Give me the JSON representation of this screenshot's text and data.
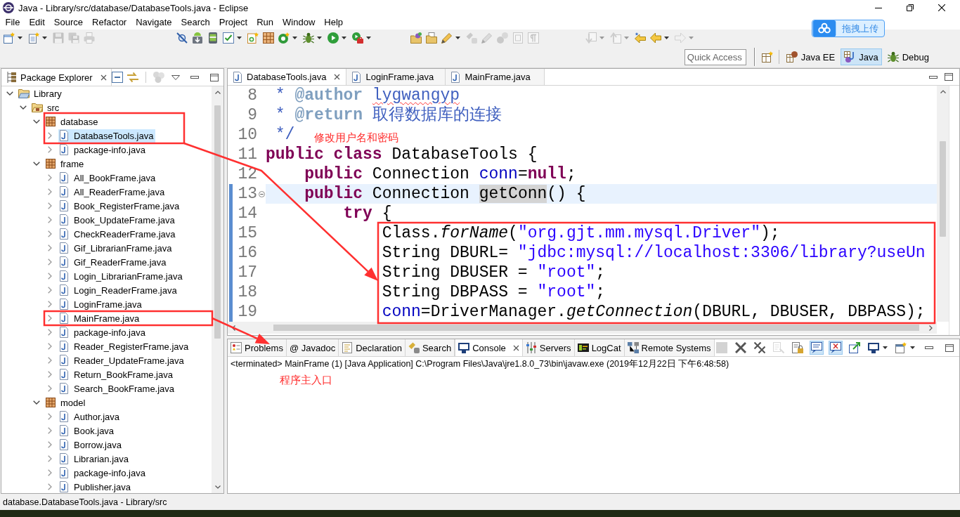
{
  "window": {
    "title": "Java - Library/src/database/DatabaseTools.java - Eclipse"
  },
  "menu": [
    "File",
    "Edit",
    "Source",
    "Refactor",
    "Navigate",
    "Search",
    "Project",
    "Run",
    "Window",
    "Help"
  ],
  "toolbar": {
    "groups": [
      [
        {
          "kind": "new",
          "dropdown": true,
          "disabled": false
        },
        {
          "kind": "newfile",
          "dropdown": true,
          "disabled": false
        },
        {
          "kind": "save",
          "dropdown": false,
          "disabled": true
        },
        {
          "kind": "saveall",
          "dropdown": false,
          "disabled": true
        },
        {
          "kind": "print",
          "dropdown": false,
          "disabled": true
        }
      ],
      [
        {
          "kind": "skipbp",
          "dropdown": false,
          "disabled": false
        },
        {
          "kind": "sdk",
          "dropdown": false,
          "disabled": false
        },
        {
          "kind": "avd",
          "dropdown": false,
          "disabled": false
        },
        {
          "kind": "task",
          "dropdown": true,
          "disabled": false
        },
        {
          "kind": "newandroid",
          "dropdown": false,
          "disabled": false
        },
        {
          "kind": "grid",
          "dropdown": false,
          "disabled": false
        },
        {
          "kind": "ring",
          "dropdown": true,
          "disabled": false
        },
        {
          "kind": "bug",
          "dropdown": true,
          "disabled": false
        },
        {
          "kind": "run",
          "dropdown": true,
          "disabled": false
        },
        {
          "kind": "ext",
          "dropdown": true,
          "disabled": false
        }
      ],
      [
        {
          "kind": "opentype",
          "dropdown": false,
          "disabled": false
        },
        {
          "kind": "opentask",
          "dropdown": false,
          "disabled": false
        },
        {
          "kind": "pen",
          "dropdown": true,
          "disabled": false
        },
        {
          "kind": "flash",
          "dropdown": false,
          "disabled": true
        },
        {
          "kind": "pen",
          "dropdown": false,
          "disabled": true
        },
        {
          "kind": "marker",
          "dropdown": false,
          "disabled": true
        },
        {
          "kind": "block",
          "dropdown": false,
          "disabled": true
        },
        {
          "kind": "pilcrow",
          "dropdown": false,
          "disabled": true
        }
      ],
      [
        {
          "kind": "nextann",
          "dropdown": true,
          "disabled": true
        },
        {
          "kind": "prevann",
          "dropdown": true,
          "disabled": true
        },
        {
          "kind": "lastedit",
          "dropdown": false,
          "disabled": false
        },
        {
          "kind": "back",
          "dropdown": true,
          "disabled": false
        },
        {
          "kind": "fwd",
          "dropdown": true,
          "disabled": true
        }
      ]
    ]
  },
  "upload_button": {
    "label": "拖拽上传"
  },
  "quick_access": {
    "placeholder": "Quick Access"
  },
  "perspectives": [
    {
      "kind": "javaee",
      "label": "Java EE",
      "selected": false
    },
    {
      "kind": "java",
      "label": "Java",
      "selected": true
    },
    {
      "kind": "debug",
      "label": "Debug",
      "selected": false
    }
  ],
  "package_explorer": {
    "title": "Package Explorer",
    "tree": [
      {
        "label": "Library",
        "kind": "project",
        "expanded": true,
        "selected": false,
        "children": [
          {
            "label": "src",
            "kind": "source_folder",
            "expanded": true,
            "selected": false,
            "children": [
              {
                "label": "database",
                "kind": "package",
                "expanded": true,
                "selected": false,
                "children": [
                  {
                    "label": "DatabaseTools.java",
                    "kind": "file",
                    "expanded": false,
                    "selected": true
                  },
                  {
                    "label": "package-info.java",
                    "kind": "file",
                    "expanded": false,
                    "selected": false
                  }
                ]
              },
              {
                "label": "frame",
                "kind": "package",
                "expanded": true,
                "selected": false,
                "children": [
                  {
                    "label": "All_BookFrame.java",
                    "kind": "file",
                    "expanded": false,
                    "selected": false
                  },
                  {
                    "label": "All_ReaderFrame.java",
                    "kind": "file",
                    "expanded": false,
                    "selected": false
                  },
                  {
                    "label": "Book_RegisterFrame.java",
                    "kind": "file",
                    "expanded": false,
                    "selected": false
                  },
                  {
                    "label": "Book_UpdateFrame.java",
                    "kind": "file",
                    "expanded": false,
                    "selected": false
                  },
                  {
                    "label": "CheckReaderFrame.java",
                    "kind": "file",
                    "expanded": false,
                    "selected": false
                  },
                  {
                    "label": "Gif_LibrarianFrame.java",
                    "kind": "file",
                    "expanded": false,
                    "selected": false
                  },
                  {
                    "label": "Gif_ReaderFrame.java",
                    "kind": "file",
                    "expanded": false,
                    "selected": false
                  },
                  {
                    "label": "Login_LibrarianFrame.java",
                    "kind": "file",
                    "expanded": false,
                    "selected": false
                  },
                  {
                    "label": "Login_ReaderFrame.java",
                    "kind": "file",
                    "expanded": false,
                    "selected": false
                  },
                  {
                    "label": "LoginFrame.java",
                    "kind": "file",
                    "expanded": false,
                    "selected": false
                  },
                  {
                    "label": "MainFrame.java",
                    "kind": "file",
                    "expanded": false,
                    "selected": false
                  },
                  {
                    "label": "package-info.java",
                    "kind": "file",
                    "expanded": false,
                    "selected": false
                  },
                  {
                    "label": "Reader_RegisterFrame.java",
                    "kind": "file",
                    "expanded": false,
                    "selected": false
                  },
                  {
                    "label": "Reader_UpdateFrame.java",
                    "kind": "file",
                    "expanded": false,
                    "selected": false
                  },
                  {
                    "label": "Return_BookFrame.java",
                    "kind": "file",
                    "expanded": false,
                    "selected": false
                  },
                  {
                    "label": "Search_BookFrame.java",
                    "kind": "file",
                    "expanded": false,
                    "selected": false
                  }
                ]
              },
              {
                "label": "model",
                "kind": "package",
                "expanded": true,
                "selected": false,
                "children": [
                  {
                    "label": "Author.java",
                    "kind": "file",
                    "expanded": false,
                    "selected": false
                  },
                  {
                    "label": "Book.java",
                    "kind": "file",
                    "expanded": false,
                    "selected": false
                  },
                  {
                    "label": "Borrow.java",
                    "kind": "file",
                    "expanded": false,
                    "selected": false
                  },
                  {
                    "label": "Librarian.java",
                    "kind": "file",
                    "expanded": false,
                    "selected": false
                  },
                  {
                    "label": "package-info.java",
                    "kind": "file",
                    "expanded": false,
                    "selected": false
                  },
                  {
                    "label": "Publisher.java",
                    "kind": "file",
                    "expanded": false,
                    "selected": false
                  }
                ]
              }
            ]
          }
        ]
      }
    ]
  },
  "editor": {
    "tabs": [
      {
        "label": "DatabaseTools.java",
        "selected": true
      },
      {
        "label": "LoginFrame.java",
        "selected": false
      },
      {
        "label": "MainFrame.java",
        "selected": false
      }
    ],
    "lines": [
      {
        "number": "8",
        "current": false,
        "range": false,
        "foldable": false,
        "tokens": [
          {
            "text": " * ",
            "kind": "doc"
          },
          {
            "text": "@author ",
            "kind": "doctag"
          },
          {
            "text": "lygwangyp",
            "kind": "misspelled"
          }
        ]
      },
      {
        "number": "9",
        "current": false,
        "range": false,
        "foldable": false,
        "tokens": [
          {
            "text": " * ",
            "kind": "doc"
          },
          {
            "text": "@return ",
            "kind": "doctag"
          },
          {
            "text": "取得数据库的连接",
            "kind": "doc"
          }
        ]
      },
      {
        "number": "10",
        "current": false,
        "range": false,
        "foldable": false,
        "tokens": [
          {
            "text": " */",
            "kind": "doc"
          }
        ]
      },
      {
        "number": "11",
        "current": false,
        "range": false,
        "foldable": false,
        "tokens": [
          {
            "text": "public class",
            "kind": "kw"
          },
          {
            "text": " DatabaseTools {",
            "kind": "plain"
          }
        ]
      },
      {
        "number": "12",
        "current": false,
        "range": false,
        "foldable": false,
        "tokens": [
          {
            "text": "    public",
            "kind": "kw"
          },
          {
            "text": " Connection ",
            "kind": "plain"
          },
          {
            "text": "conn",
            "kind": "field"
          },
          {
            "text": "=",
            "kind": "plain"
          },
          {
            "text": "null",
            "kind": "kw"
          },
          {
            "text": ";",
            "kind": "plain"
          }
        ]
      },
      {
        "number": "13",
        "current": true,
        "range": true,
        "foldable": true,
        "tokens": [
          {
            "text": "    public",
            "kind": "kw"
          },
          {
            "text": " Connection ",
            "kind": "plain"
          },
          {
            "text": "getConn",
            "kind": "occurrence"
          },
          {
            "text": "() {",
            "kind": "plain"
          }
        ]
      },
      {
        "number": "14",
        "current": false,
        "range": true,
        "foldable": false,
        "tokens": [
          {
            "text": "        try",
            "kind": "kw"
          },
          {
            "text": " {",
            "kind": "plain"
          }
        ]
      },
      {
        "number": "15",
        "current": false,
        "range": true,
        "foldable": false,
        "tokens": [
          {
            "text": "            Class.",
            "kind": "plain"
          },
          {
            "text": "forName",
            "kind": "static"
          },
          {
            "text": "(",
            "kind": "plain"
          },
          {
            "text": "\"org.gjt.mm.mysql.Driver\"",
            "kind": "str"
          },
          {
            "text": ");",
            "kind": "plain"
          }
        ]
      },
      {
        "number": "16",
        "current": false,
        "range": true,
        "foldable": false,
        "tokens": [
          {
            "text": "            String DBURL= ",
            "kind": "plain"
          },
          {
            "text": "\"jdbc:mysql://localhost:3306/library?useUn",
            "kind": "str"
          }
        ]
      },
      {
        "number": "17",
        "current": false,
        "range": true,
        "foldable": false,
        "tokens": [
          {
            "text": "            String DBUSER = ",
            "kind": "plain"
          },
          {
            "text": "\"root\"",
            "kind": "str"
          },
          {
            "text": ";",
            "kind": "plain"
          }
        ]
      },
      {
        "number": "18",
        "current": false,
        "range": true,
        "foldable": false,
        "tokens": [
          {
            "text": "            String DBPASS = ",
            "kind": "plain"
          },
          {
            "text": "\"root\"",
            "kind": "str"
          },
          {
            "text": ";",
            "kind": "plain"
          }
        ]
      },
      {
        "number": "19",
        "current": false,
        "range": true,
        "foldable": false,
        "tokens": [
          {
            "text": "            conn",
            "kind": "field"
          },
          {
            "text": "=DriverManager.",
            "kind": "plain"
          },
          {
            "text": "getConnection",
            "kind": "static"
          },
          {
            "text": "(DBURL, DBUSER, DBPASS);",
            "kind": "plain"
          }
        ]
      }
    ]
  },
  "bottom_panel": {
    "tabs": [
      {
        "kind": "problems",
        "label": "Problems",
        "selected": false
      },
      {
        "kind": "javadoc",
        "label": "@ Javadoc",
        "selected": false
      },
      {
        "kind": "declaration",
        "label": "Declaration",
        "selected": false
      },
      {
        "kind": "search",
        "label": "Search",
        "selected": false
      },
      {
        "kind": "console",
        "label": "Console",
        "selected": true
      },
      {
        "kind": "servers",
        "label": "Servers",
        "selected": false
      },
      {
        "kind": "logcat",
        "label": "LogCat",
        "selected": false
      },
      {
        "kind": "remote",
        "label": "Remote Systems",
        "selected": false
      }
    ],
    "toolbar": [
      {
        "kind": "stop",
        "disabled": true,
        "pressed": false,
        "dropdown": false
      },
      {
        "kind": "remove",
        "disabled": false,
        "pressed": false,
        "dropdown": false
      },
      {
        "kind": "removeall",
        "disabled": false,
        "pressed": false,
        "dropdown": false
      },
      {
        "kind": "clear",
        "disabled": true,
        "pressed": false,
        "dropdown": false
      },
      {
        "kind": "scrolllock",
        "disabled": false,
        "pressed": false,
        "dropdown": false
      },
      {
        "kind": "stdout",
        "disabled": false,
        "pressed": true,
        "dropdown": false
      },
      {
        "kind": "stderr",
        "disabled": false,
        "pressed": true,
        "dropdown": false
      },
      {
        "kind": "pin",
        "disabled": false,
        "pressed": false,
        "dropdown": false
      },
      {
        "kind": "display",
        "disabled": false,
        "pressed": false,
        "dropdown": true
      },
      {
        "kind": "newconsole",
        "disabled": false,
        "pressed": false,
        "dropdown": true
      }
    ],
    "console_header": "<terminated> MainFrame (1) [Java Application] C:\\Program Files\\Java\\jre1.8.0_73\\bin\\javaw.exe (2019年12月22日 下午6:48:58)"
  },
  "annotations": [
    {
      "text": "修改用户名和密码"
    },
    {
      "text": "程序主入口"
    }
  ],
  "status_bar": "database.DatabaseTools.java - Library/src"
}
